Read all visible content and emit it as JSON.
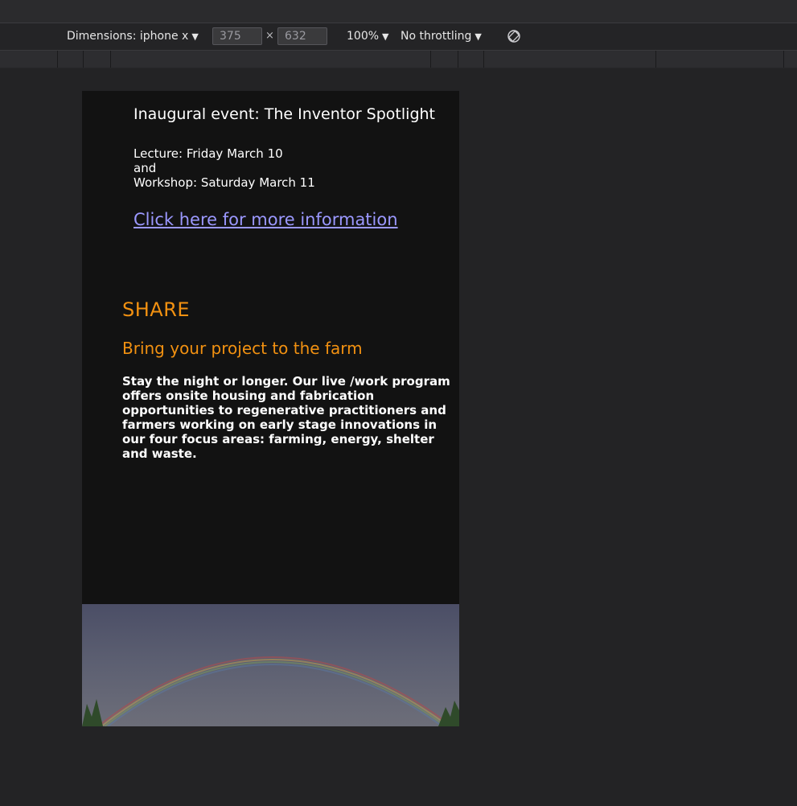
{
  "devtools": {
    "dimensions_label": "Dimensions: iphone x",
    "width_value": "375",
    "height_value": "632",
    "times_symbol": "×",
    "zoom": "100%",
    "throttling": "No throttling"
  },
  "page": {
    "event_title": "Inaugural event: The Inventor Spotlight",
    "event_lines": [
      "Lecture: Friday March 10",
      "and",
      "Workshop: Saturday March 11"
    ],
    "event_link": "Click here for more information",
    "share_heading": "SHARE",
    "share_subheading": "Bring your project to the farm",
    "share_body": "Stay the night or longer. Our live /work program offers onsite housing and fabrication opportunities to regenerative practitioners and farmers working on early stage innovations in our four focus areas: farming, energy, shelter and waste."
  },
  "colors": {
    "accent_orange": "#f29111",
    "link_blue": "#9b98ff",
    "page_bg": "#121212",
    "devtools_bg": "#232325"
  },
  "icons": {
    "rotate": "rotate-icon"
  }
}
